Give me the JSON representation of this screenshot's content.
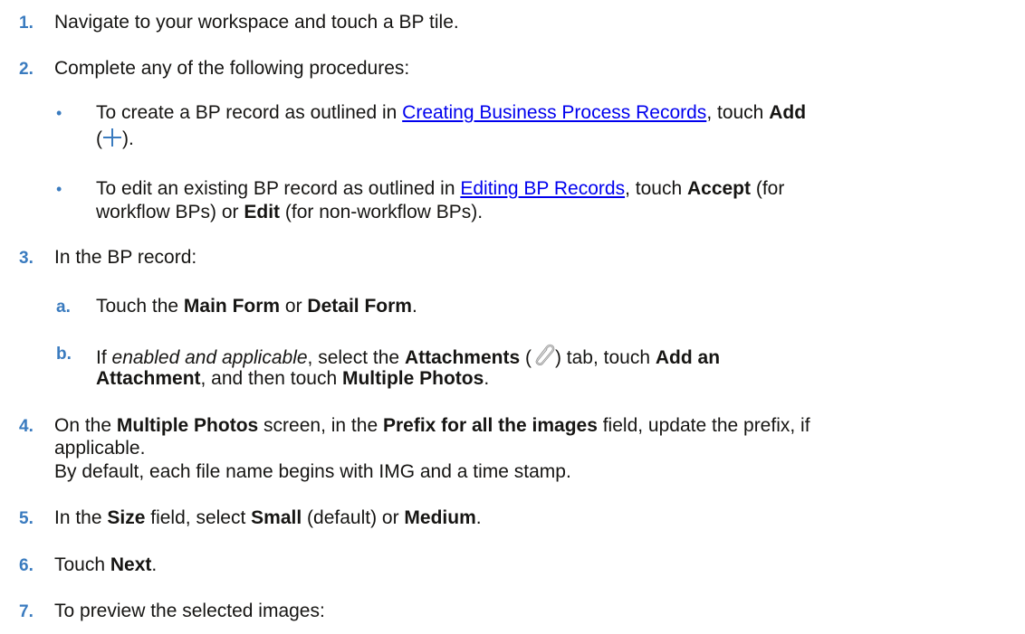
{
  "steps": [
    {
      "num": "1.",
      "text": "Navigate to your workspace and touch a BP tile."
    },
    {
      "num": "2.",
      "text": "Complete any of the following procedures:"
    },
    {
      "num": "3.",
      "text": "In the BP record:"
    },
    {
      "num": "4."
    },
    {
      "num": "5."
    },
    {
      "num": "6."
    },
    {
      "num": "7.",
      "text": "To preview the selected images:"
    }
  ],
  "bullets": {
    "b1": {
      "pre": "To create a BP record as outlined in ",
      "link": "Creating Business Process Records",
      "mid": ", touch ",
      "bold": "Add",
      "line2_open": "(",
      "line2_close": ")."
    },
    "b2": {
      "pre": "To edit an existing BP record as outlined in ",
      "link": "Editing BP Records",
      "mid": ", touch ",
      "bold1": "Accept",
      "post1": " (for",
      "line2_pre": "workflow BPs) or ",
      "bold2": "Edit",
      "line2_post": " (for non-workflow BPs)."
    }
  },
  "substeps": {
    "a": {
      "label": "a.",
      "pre": "Touch the ",
      "bold1": "Main Form",
      "mid": " or ",
      "bold2": "Detail Form",
      "post": "."
    },
    "b": {
      "label": "b.",
      "pre": "If ",
      "italic": "enabled and applicable",
      "mid1": ", select the ",
      "bold1": "Attachments",
      "open": " (",
      "close": ") tab, touch ",
      "bold2": "Add an",
      "line2_bold": "Attachment",
      "line2_mid": ", and then touch ",
      "line2_bold2": "Multiple Photos",
      "line2_post": "."
    }
  },
  "step4": {
    "pre": "On the ",
    "bold1": "Multiple Photos",
    "mid1": " screen, in the ",
    "bold2": "Prefix for all the images",
    "post1": " field, update the prefix, if",
    "line2": "applicable.",
    "line3": "By default, each file name begins with IMG and a time stamp."
  },
  "step5": {
    "pre": "In the ",
    "bold1": "Size",
    "mid1": " field, select ",
    "bold2": "Small",
    "mid2": " (default) or ",
    "bold3": "Medium",
    "post": "."
  },
  "step6": {
    "pre": "Touch ",
    "bold": "Next",
    "post": "."
  },
  "colors": {
    "accent": "#3a7bbf",
    "link": "#0000ee",
    "text": "#161513"
  },
  "icons": [
    "plus-icon",
    "paperclip-icon"
  ]
}
